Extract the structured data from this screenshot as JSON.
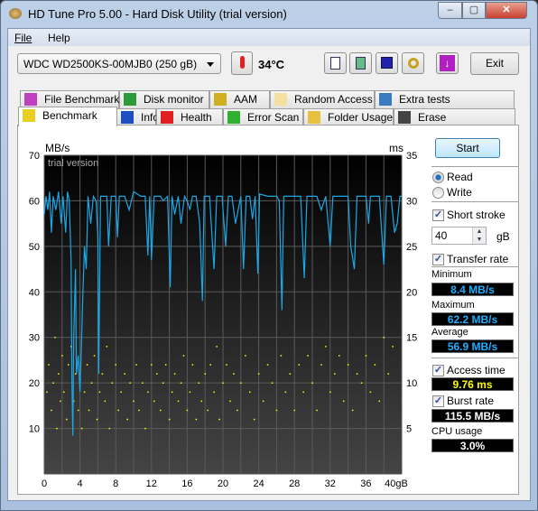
{
  "window": {
    "title": "HD Tune Pro 5.00 - Hard Disk Utility (trial version)",
    "min": "–",
    "max": "▢",
    "close": "✕"
  },
  "menu": {
    "file": "File",
    "help": "Help"
  },
  "toolbar": {
    "drive": "WDC WD2500KS-00MJB0 (250 gB)",
    "temperature": "34°C",
    "exit": "Exit",
    "icons": [
      "copy-info-icon",
      "copy-screenshot-icon",
      "save-icon",
      "options-icon",
      "download-icon"
    ]
  },
  "tabs_row1": [
    {
      "label": "File Benchmark",
      "icon": "file-benchmark-icon"
    },
    {
      "label": "Disk monitor",
      "icon": "disk-monitor-icon"
    },
    {
      "label": "AAM",
      "icon": "speaker-icon"
    },
    {
      "label": "Random Access",
      "icon": "random-access-icon"
    },
    {
      "label": "Extra tests",
      "icon": "extra-tests-icon"
    }
  ],
  "tabs_row2": [
    {
      "label": "Benchmark",
      "icon": "exclamation-icon",
      "selected": true
    },
    {
      "label": "Info",
      "icon": "info-icon"
    },
    {
      "label": "Health",
      "icon": "red-cross-icon"
    },
    {
      "label": "Error Scan",
      "icon": "magnifier-icon"
    },
    {
      "label": "Folder Usage",
      "icon": "folder-icon"
    },
    {
      "label": "Erase",
      "icon": "trash-icon"
    }
  ],
  "side": {
    "start": "Start",
    "read": "Read",
    "write": "Write",
    "mode": "read",
    "short_stroke": "Short stroke",
    "short_stroke_checked": true,
    "stroke_value": "40",
    "stroke_unit": "gB",
    "transfer_rate": "Transfer rate",
    "transfer_checked": true,
    "minimum_label": "Minimum",
    "minimum": "8.4 MB/s",
    "maximum_label": "Maximum",
    "maximum": "62.2 MB/s",
    "average_label": "Average",
    "average": "56.9 MB/s",
    "access_time": "Access time",
    "access_checked": true,
    "access_value": "9.76 ms",
    "burst_rate": "Burst rate",
    "burst_checked": true,
    "burst_value": "115.5 MB/s",
    "cpu_label": "CPU usage",
    "cpu_value": "3.0%"
  },
  "colors": {
    "transfer": "#1aa8e8",
    "access": "#ffff00",
    "stat_blue": "#1ab0ff",
    "stat_yellow": "#ffff00"
  },
  "chart_data": {
    "type": "line",
    "watermark": "trial version",
    "ylabel_left": "MB/s",
    "ylabel_right": "ms",
    "xunit": "gB",
    "xlim": [
      0,
      40
    ],
    "ylim_left": [
      0,
      70
    ],
    "ylim_right": [
      0,
      35
    ],
    "grid": true,
    "xticks": [
      "0",
      "4",
      "8",
      "12",
      "16",
      "20",
      "24",
      "28",
      "32",
      "36",
      "40gB"
    ],
    "yticks_left": [
      "10",
      "20",
      "30",
      "40",
      "50",
      "60",
      "70"
    ],
    "yticks_right": [
      "5",
      "10",
      "15",
      "20",
      "25",
      "30",
      "35"
    ],
    "series": [
      {
        "kind": "line",
        "axis": "left",
        "points": [
          [
            0,
            57
          ],
          [
            0.2,
            61
          ],
          [
            0.4,
            58
          ],
          [
            0.6,
            62
          ],
          [
            0.8,
            53
          ],
          [
            1,
            61
          ],
          [
            1.3,
            58
          ],
          [
            1.6,
            62
          ],
          [
            1.9,
            55
          ],
          [
            2.1,
            61
          ],
          [
            2.4,
            53
          ],
          [
            2.6,
            62
          ],
          [
            2.8,
            60
          ],
          [
            3.0,
            47
          ],
          [
            3.1,
            20
          ],
          [
            3.2,
            8.4
          ],
          [
            3.3,
            30
          ],
          [
            3.5,
            45
          ],
          [
            3.6,
            22
          ],
          [
            3.8,
            26
          ],
          [
            4.0,
            18
          ],
          [
            4.1,
            24
          ],
          [
            4.3,
            38
          ],
          [
            4.5,
            50
          ],
          [
            4.7,
            45
          ],
          [
            4.9,
            61
          ],
          [
            5.2,
            55
          ],
          [
            5.5,
            61
          ],
          [
            5.8,
            60
          ],
          [
            6.0,
            52
          ],
          [
            6.1,
            22
          ],
          [
            6.3,
            61
          ],
          [
            6.6,
            61
          ],
          [
            7.0,
            61
          ],
          [
            7.2,
            50
          ],
          [
            7.5,
            61
          ],
          [
            8.0,
            61
          ],
          [
            8.2,
            52
          ],
          [
            8.4,
            61
          ],
          [
            9,
            61
          ],
          [
            9.5,
            58
          ],
          [
            10,
            62
          ],
          [
            10.8,
            61
          ],
          [
            11.3,
            61
          ],
          [
            11.6,
            48
          ],
          [
            11.8,
            61
          ],
          [
            12,
            47
          ],
          [
            12.3,
            61
          ],
          [
            13,
            61
          ],
          [
            13.3,
            60
          ],
          [
            13.8,
            61
          ],
          [
            14.1,
            41
          ],
          [
            14.3,
            61
          ],
          [
            14.6,
            57
          ],
          [
            15,
            61
          ],
          [
            15.3,
            55
          ],
          [
            15.7,
            61
          ],
          [
            16,
            60
          ],
          [
            16.3,
            58
          ],
          [
            16.6,
            61
          ],
          [
            17,
            61
          ],
          [
            17.4,
            55
          ],
          [
            17.7,
            38
          ],
          [
            17.9,
            61
          ],
          [
            18.5,
            61
          ],
          [
            19,
            45
          ],
          [
            19.3,
            61
          ],
          [
            19.9,
            61
          ],
          [
            20.3,
            50
          ],
          [
            20.6,
            61
          ],
          [
            21,
            61
          ],
          [
            21.4,
            55
          ],
          [
            22,
            61
          ],
          [
            22.3,
            45
          ],
          [
            22.6,
            61
          ],
          [
            23,
            61
          ],
          [
            23.3,
            56
          ],
          [
            23.6,
            61
          ],
          [
            23.9,
            44
          ],
          [
            24.1,
            61.5
          ],
          [
            25,
            61
          ],
          [
            26,
            61
          ],
          [
            26.3,
            60
          ],
          [
            26.6,
            36
          ],
          [
            26.8,
            61
          ],
          [
            28,
            61
          ],
          [
            28.7,
            61
          ],
          [
            29.1,
            43
          ],
          [
            29.4,
            61
          ],
          [
            30,
            61
          ],
          [
            30.5,
            61
          ],
          [
            31,
            58
          ],
          [
            31.5,
            61
          ],
          [
            32,
            50
          ],
          [
            32.3,
            61
          ],
          [
            33,
            61
          ],
          [
            34,
            61
          ],
          [
            34.3,
            50
          ],
          [
            34.7,
            45
          ],
          [
            35,
            61
          ],
          [
            36,
            61
          ],
          [
            36.3,
            55
          ],
          [
            36.5,
            61
          ],
          [
            37.5,
            61
          ],
          [
            38,
            46
          ],
          [
            38.3,
            61
          ],
          [
            38.8,
            61
          ],
          [
            39.2,
            53
          ],
          [
            39.5,
            55
          ],
          [
            39.8,
            61
          ],
          [
            40,
            61
          ]
        ]
      },
      {
        "kind": "scatter",
        "axis": "right",
        "points": [
          [
            0.3,
            9
          ],
          [
            0.5,
            12
          ],
          [
            0.8,
            7
          ],
          [
            1,
            10
          ],
          [
            1.2,
            15
          ],
          [
            1.4,
            5
          ],
          [
            1.6,
            11
          ],
          [
            1.8,
            8
          ],
          [
            2,
            13
          ],
          [
            2.2,
            9
          ],
          [
            2.5,
            6
          ],
          [
            2.7,
            12
          ],
          [
            3,
            14
          ],
          [
            3.3,
            8
          ],
          [
            3.5,
            11
          ],
          [
            3.8,
            7
          ],
          [
            4,
            10
          ],
          [
            4.2,
            5
          ],
          [
            4.5,
            9
          ],
          [
            4.8,
            12
          ],
          [
            5,
            7
          ],
          [
            5.3,
            10
          ],
          [
            5.6,
            13
          ],
          [
            5.9,
            6
          ],
          [
            6.2,
            9
          ],
          [
            6.5,
            11
          ],
          [
            6.8,
            8
          ],
          [
            7,
            14
          ],
          [
            7.3,
            5
          ],
          [
            7.6,
            10
          ],
          [
            8,
            12
          ],
          [
            8.3,
            7
          ],
          [
            8.6,
            9
          ],
          [
            9,
            11
          ],
          [
            9.3,
            6
          ],
          [
            9.6,
            10
          ],
          [
            10,
            8
          ],
          [
            10.3,
            12
          ],
          [
            10.6,
            7
          ],
          [
            11,
            10
          ],
          [
            11.3,
            5
          ],
          [
            11.6,
            9
          ],
          [
            12,
            12
          ],
          [
            12.3,
            8
          ],
          [
            12.6,
            11
          ],
          [
            13,
            7
          ],
          [
            13.3,
            10
          ],
          [
            13.6,
            12
          ],
          [
            14,
            6
          ],
          [
            14.3,
            9
          ],
          [
            14.6,
            11
          ],
          [
            15,
            8
          ],
          [
            15.3,
            10
          ],
          [
            15.6,
            13
          ],
          [
            16,
            7
          ],
          [
            16.3,
            9
          ],
          [
            16.6,
            12
          ],
          [
            17,
            6
          ],
          [
            17.3,
            10
          ],
          [
            17.6,
            8
          ],
          [
            18,
            11
          ],
          [
            18.3,
            7
          ],
          [
            18.6,
            12
          ],
          [
            19,
            9
          ],
          [
            19.3,
            14
          ],
          [
            19.6,
            6
          ],
          [
            20,
            10
          ],
          [
            20.4,
            12
          ],
          [
            20.8,
            8
          ],
          [
            21.2,
            11
          ],
          [
            21.6,
            7
          ],
          [
            22,
            10
          ],
          [
            22.5,
            13
          ],
          [
            23,
            9
          ],
          [
            23.5,
            6
          ],
          [
            24,
            11
          ],
          [
            24.5,
            8
          ],
          [
            25,
            12
          ],
          [
            25.5,
            10
          ],
          [
            26,
            7
          ],
          [
            26.5,
            13
          ],
          [
            27,
            9
          ],
          [
            27.5,
            11
          ],
          [
            28,
            7
          ],
          [
            28.5,
            12
          ],
          [
            29,
            9
          ],
          [
            29.5,
            13
          ],
          [
            30,
            10
          ],
          [
            30.5,
            7
          ],
          [
            31,
            12
          ],
          [
            31.5,
            14
          ],
          [
            32,
            9
          ],
          [
            32.5,
            11
          ],
          [
            33,
            13
          ],
          [
            33.5,
            8
          ],
          [
            34,
            12
          ],
          [
            34.5,
            7
          ],
          [
            35,
            11
          ],
          [
            35.5,
            10
          ],
          [
            36,
            13
          ],
          [
            36.5,
            9
          ],
          [
            37,
            12
          ],
          [
            37.5,
            8
          ],
          [
            38,
            15
          ],
          [
            38.5,
            11
          ],
          [
            39,
            14
          ]
        ]
      }
    ]
  }
}
